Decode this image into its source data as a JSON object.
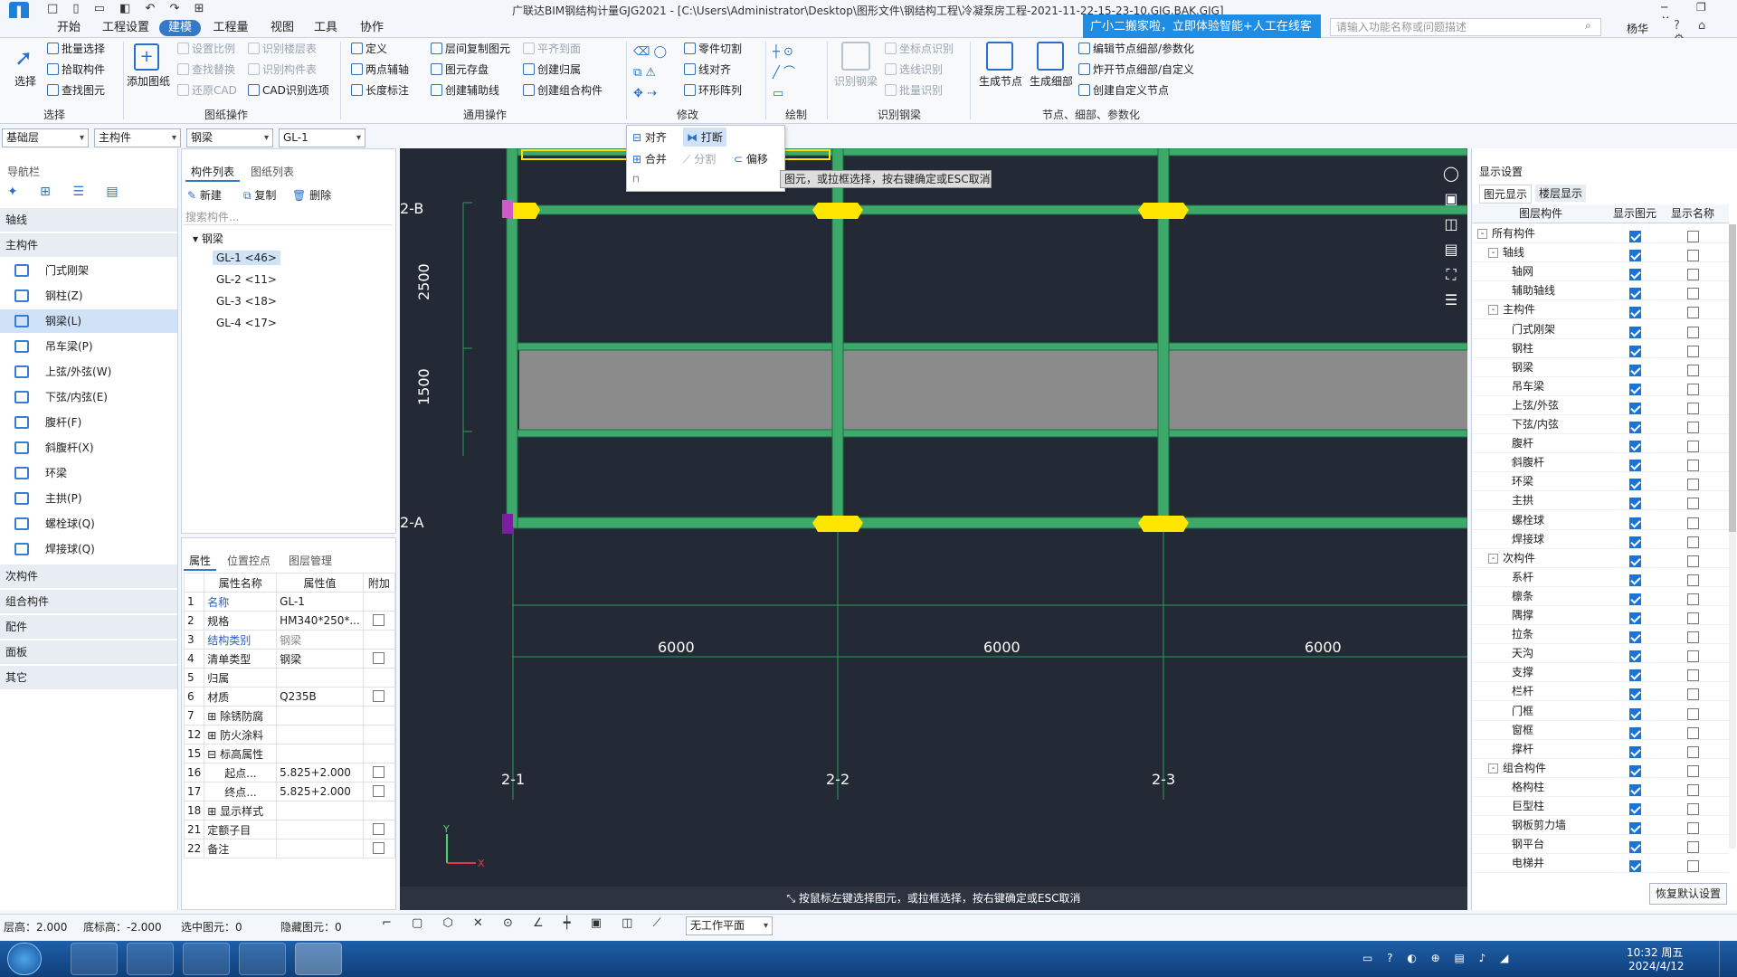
{
  "app": {
    "title": "广联达BIM钢结构计量GJG2021 - [C:\\Users\\Administrator\\Desktop\\图形文件\\钢结构工程\\冷凝泵房工程-2021-11-22-15-23-10.GJG.BAK.GJG]"
  },
  "menu": [
    "开始",
    "工程设置",
    "建模",
    "工程量",
    "视图",
    "工具",
    "协作"
  ],
  "menu_active": "建模",
  "tip": "广小二搬家啦，立即体验智能+人工在线客服",
  "search_placeholder": "请输入功能名称或问题描述",
  "user": "杨华",
  "ribbon": {
    "select": {
      "label": "选择",
      "items": [
        "批量选择",
        "拾取构件",
        "查找图元"
      ],
      "sec": "选择"
    },
    "drawing": {
      "add": "添加图纸",
      "items": [
        "设置比例",
        "识别楼层表",
        "查找替换",
        "识别构件表",
        "还原CAD",
        "CAD识别选项"
      ],
      "sec": "图纸操作"
    },
    "general": {
      "items": [
        "定义",
        "层间复制图元",
        "平齐到面",
        "两点辅轴",
        "图元存盘",
        "创建归属",
        "长度标注",
        "创建辅助线",
        "创建组合构件"
      ],
      "sec": "通用操作"
    },
    "modify": {
      "items": [
        "零件切割",
        "线对齐",
        "环形阵列"
      ],
      "sec": "修改"
    },
    "draw": {
      "sec": "绘制"
    },
    "recognize": {
      "items": [
        "识别钢梁",
        "坐标点识别",
        "选线识别",
        "批量识别"
      ],
      "sec": "识别钢梁"
    },
    "nodes": {
      "items": [
        "生成节点",
        "生成细部",
        "编辑节点细部/参数化",
        "炸开节点细部/自定义",
        "创建自定义节点"
      ],
      "sec": "节点、细部、参数化"
    }
  },
  "popup": {
    "items": [
      "对齐",
      "打断",
      "合并",
      "分割",
      "偏移"
    ]
  },
  "hint": "图元，或拉框选择，按右键确定或ESC取消",
  "selectors": [
    "基础层",
    "主构件",
    "钢梁",
    "GL-1"
  ],
  "nav": {
    "title": "导航栏",
    "groups": [
      "轴线",
      "主构件",
      "次构件",
      "组合构件",
      "配件",
      "面板",
      "其它"
    ],
    "items": [
      "门式刚架",
      "钢柱(Z)",
      "钢梁(L)",
      "吊车梁(P)",
      "上弦/外弦(W)",
      "下弦/内弦(E)",
      "腹杆(F)",
      "斜腹杆(X)",
      "环梁",
      "主拱(P)",
      "螺栓球(Q)",
      "焊接球(Q)"
    ]
  },
  "complist": {
    "tabs": [
      "构件列表",
      "图纸列表"
    ],
    "actions": [
      "新建",
      "复制",
      "删除"
    ],
    "search": "搜索构件...",
    "root": "钢梁",
    "items": [
      "GL-1 <46>",
      "GL-2 <11>",
      "GL-3 <18>",
      "GL-4 <17>"
    ]
  },
  "props": {
    "tabs": [
      "属性",
      "位置控点",
      "图层管理"
    ],
    "headers": [
      "属性名称",
      "属性值",
      "附加"
    ],
    "rows": [
      {
        "n": "1",
        "name": "名称",
        "val": "GL-1",
        "blue": true,
        "cb": false
      },
      {
        "n": "2",
        "name": "规格",
        "val": "HM340*250*...",
        "blue": false,
        "cb": true
      },
      {
        "n": "3",
        "name": "结构类别",
        "val": "钢梁",
        "blue": true,
        "cb": false,
        "gray": true
      },
      {
        "n": "4",
        "name": "清单类型",
        "val": "钢梁",
        "blue": false,
        "cb": true
      },
      {
        "n": "5",
        "name": "归属",
        "val": "",
        "blue": false,
        "cb": false
      },
      {
        "n": "6",
        "name": "材质",
        "val": "Q235B",
        "blue": false,
        "cb": true
      },
      {
        "n": "7",
        "name": "除锈防腐",
        "val": "",
        "blue": false,
        "cb": false,
        "exp": "+"
      },
      {
        "n": "12",
        "name": "防火涂料",
        "val": "",
        "blue": false,
        "cb": false,
        "exp": "+"
      },
      {
        "n": "15",
        "name": "标高属性",
        "val": "",
        "blue": false,
        "cb": false,
        "exp": "-"
      },
      {
        "n": "16",
        "name": "起点...",
        "val": "5.825+2.000",
        "blue": false,
        "cb": true,
        "ind": true
      },
      {
        "n": "17",
        "name": "终点...",
        "val": "5.825+2.000",
        "blue": false,
        "cb": true,
        "ind": true
      },
      {
        "n": "18",
        "name": "显示样式",
        "val": "",
        "blue": false,
        "cb": false,
        "exp": "+"
      },
      {
        "n": "21",
        "name": "定额子目",
        "val": "",
        "blue": false,
        "cb": true
      },
      {
        "n": "22",
        "name": "备注",
        "val": "",
        "blue": false,
        "cb": true
      }
    ]
  },
  "canvas": {
    "axes_y": [
      "2-B",
      "2-A"
    ],
    "axes_x": [
      "2-1",
      "2-2",
      "2-3"
    ],
    "dims_h": [
      "6000",
      "6000",
      "6000"
    ],
    "dims_v": [
      "2500",
      "1500"
    ],
    "status": "按鼠标左键选择图元，或拉框选择，按右键确定或ESC取消"
  },
  "display": {
    "title": "显示设置",
    "tabs": [
      "图元显示",
      "楼层显示"
    ],
    "headers": [
      "图层构件",
      "显示图元",
      "显示名称"
    ],
    "rows": [
      {
        "name": "所有构件",
        "lvl": 0,
        "tog": "-"
      },
      {
        "name": "轴线",
        "lvl": 1,
        "tog": "-"
      },
      {
        "name": "轴网",
        "lvl": 2
      },
      {
        "name": "辅助轴线",
        "lvl": 2
      },
      {
        "name": "主构件",
        "lvl": 1,
        "tog": "-"
      },
      {
        "name": "门式刚架",
        "lvl": 2
      },
      {
        "name": "钢柱",
        "lvl": 2
      },
      {
        "name": "钢梁",
        "lvl": 2
      },
      {
        "name": "吊车梁",
        "lvl": 2
      },
      {
        "name": "上弦/外弦",
        "lvl": 2
      },
      {
        "name": "下弦/内弦",
        "lvl": 2
      },
      {
        "name": "腹杆",
        "lvl": 2
      },
      {
        "name": "斜腹杆",
        "lvl": 2
      },
      {
        "name": "环梁",
        "lvl": 2
      },
      {
        "name": "主拱",
        "lvl": 2
      },
      {
        "name": "螺栓球",
        "lvl": 2
      },
      {
        "name": "焊接球",
        "lvl": 2
      },
      {
        "name": "次构件",
        "lvl": 1,
        "tog": "-"
      },
      {
        "name": "系杆",
        "lvl": 2
      },
      {
        "name": "檩条",
        "lvl": 2
      },
      {
        "name": "隅撑",
        "lvl": 2
      },
      {
        "name": "拉条",
        "lvl": 2
      },
      {
        "name": "天沟",
        "lvl": 2
      },
      {
        "name": "支撑",
        "lvl": 2
      },
      {
        "name": "栏杆",
        "lvl": 2
      },
      {
        "name": "门框",
        "lvl": 2
      },
      {
        "name": "窗框",
        "lvl": 2
      },
      {
        "name": "撑杆",
        "lvl": 2
      },
      {
        "name": "组合构件",
        "lvl": 1,
        "tog": "-"
      },
      {
        "name": "格构柱",
        "lvl": 2
      },
      {
        "name": "巨型柱",
        "lvl": 2
      },
      {
        "name": "钢板剪力墙",
        "lvl": 2
      },
      {
        "name": "钢平台",
        "lvl": 2
      },
      {
        "name": "电梯井",
        "lvl": 2
      }
    ],
    "restore": "恢复默认设置"
  },
  "status": {
    "floor_h": "层高：2.000",
    "base_h": "底标高：-2.000",
    "selected": "选中图元：0",
    "hidden": "隐藏图元：0",
    "plane": "无工作平面"
  },
  "clock": {
    "time": "10:32 周五",
    "date": "2024/4/12"
  }
}
